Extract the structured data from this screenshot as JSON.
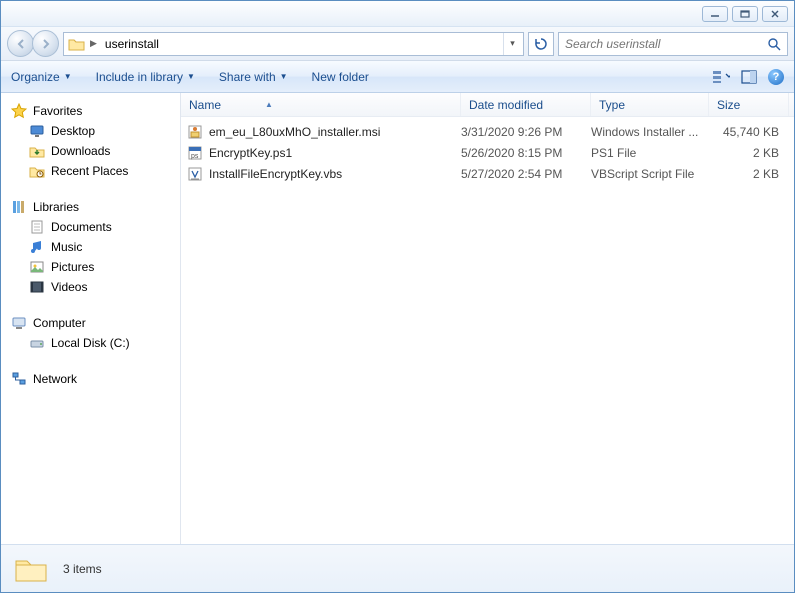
{
  "address": {
    "folder": "userinstall"
  },
  "search": {
    "placeholder": "Search userinstall"
  },
  "toolbar": {
    "organize": "Organize",
    "include": "Include in library",
    "share": "Share with",
    "newfolder": "New folder"
  },
  "columns": {
    "name": "Name",
    "date": "Date modified",
    "type": "Type",
    "size": "Size"
  },
  "sidebar": {
    "favorites": "Favorites",
    "desktop": "Desktop",
    "downloads": "Downloads",
    "recent": "Recent Places",
    "libraries": "Libraries",
    "documents": "Documents",
    "music": "Music",
    "pictures": "Pictures",
    "videos": "Videos",
    "computer": "Computer",
    "localdisk": "Local Disk (C:)",
    "network": "Network"
  },
  "files": [
    {
      "name": "em_eu_L80uxMhO_installer.msi",
      "date": "3/31/2020 9:26 PM",
      "type": "Windows Installer ...",
      "size": "45,740 KB",
      "icon": "msi"
    },
    {
      "name": "EncryptKey.ps1",
      "date": "5/26/2020 8:15 PM",
      "type": "PS1 File",
      "size": "2 KB",
      "icon": "ps1"
    },
    {
      "name": "InstallFileEncryptKey.vbs",
      "date": "5/27/2020 2:54 PM",
      "type": "VBScript Script File",
      "size": "2 KB",
      "icon": "vbs"
    }
  ],
  "status": {
    "text": "3 items"
  }
}
